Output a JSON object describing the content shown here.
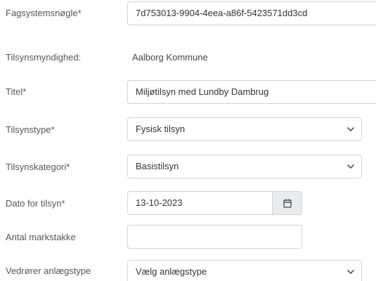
{
  "form": {
    "system_key": {
      "label": "Fagsystemsnøgle*",
      "value": "7d753013-9904-4eea-a86f-5423571dd3cd"
    },
    "authority": {
      "label": "Tilsynsmyndighed:",
      "value": "Aalborg Kommune"
    },
    "title": {
      "label": "Titel*",
      "value": "Miljøtilsyn med Lundby Dambrug"
    },
    "inspection_type": {
      "label": "Tilsynstype*",
      "selected": "Fysisk tilsyn"
    },
    "inspection_category": {
      "label": "Tilsynskategori*",
      "selected": "Basistilsyn"
    },
    "inspection_date": {
      "label": "Dato for tilsyn*",
      "value": "13-10-2023",
      "button_icon": "calendar-icon"
    },
    "field_stacks": {
      "label": "Antal markstakke",
      "value": ""
    },
    "facility_type": {
      "label": "Vedrører anlægstype",
      "selected": "Vælg anlægstype"
    }
  },
  "icons": {
    "select_arrow": "chevron-down-icon",
    "date_button": "calendar-icon"
  },
  "colors": {
    "border": "#cfd4da",
    "label": "#555555",
    "text": "#333333",
    "button_bg": "#e9ecef"
  }
}
